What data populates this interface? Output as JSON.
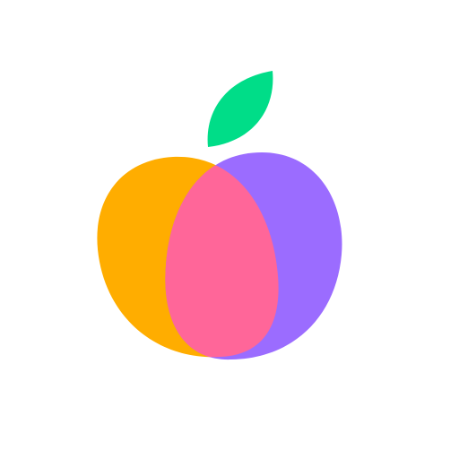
{
  "logo": {
    "name": "fruit-logo",
    "colors": {
      "background": "#FFFFFF",
      "left_lobe": "#FFAD00",
      "right_lobe": "#9B6CFF",
      "overlap": "#FF6699",
      "leaf": "#00DD88"
    }
  }
}
